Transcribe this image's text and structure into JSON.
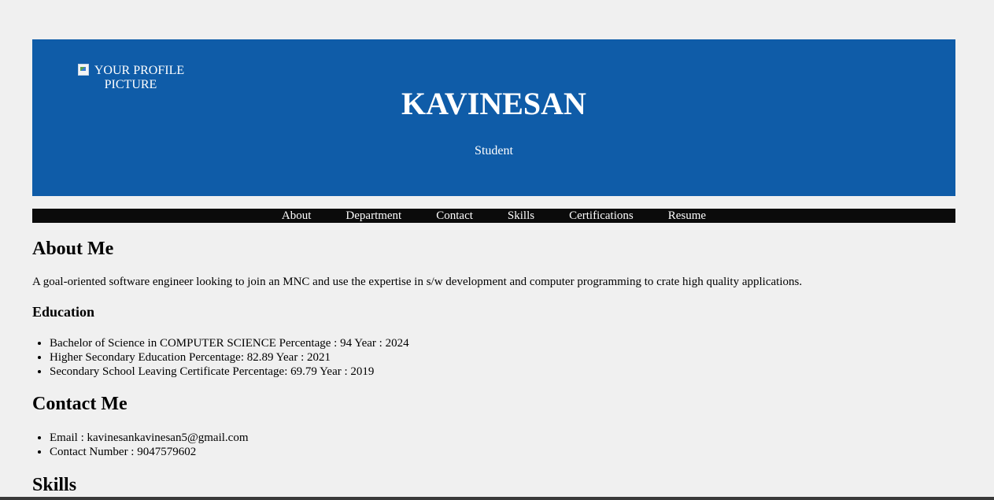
{
  "header": {
    "profile_alt": "YOUR PROFILE PICTURE",
    "name": "KAVINESAN",
    "role": "Student"
  },
  "nav": {
    "items": [
      "About",
      "Department",
      "Contact",
      "Skills",
      "Certifications",
      "Resume"
    ]
  },
  "about": {
    "title": "About Me",
    "text": "A goal-oriented software engineer looking to join an MNC and use the expertise in s/w development and computer programming to crate high quality applications."
  },
  "education": {
    "title": "Education",
    "items": [
      "Bachelor of Science in COMPUTER SCIENCE Percentage : 94 Year : 2024",
      "Higher Secondary Education Percentage: 82.89 Year : 2021",
      "Secondary School Leaving Certificate Percentage: 69.79 Year : 2019"
    ]
  },
  "contact": {
    "title": "Contact Me",
    "items": [
      "Email : kavinesankavinesan5@gmail.com",
      "Contact Number : 9047579602"
    ]
  },
  "skills": {
    "title": "Skills"
  },
  "colors": {
    "header_bg": "#0f5ca8",
    "nav_bg": "#0b0b0b",
    "page_bg": "#f0f0f0"
  }
}
